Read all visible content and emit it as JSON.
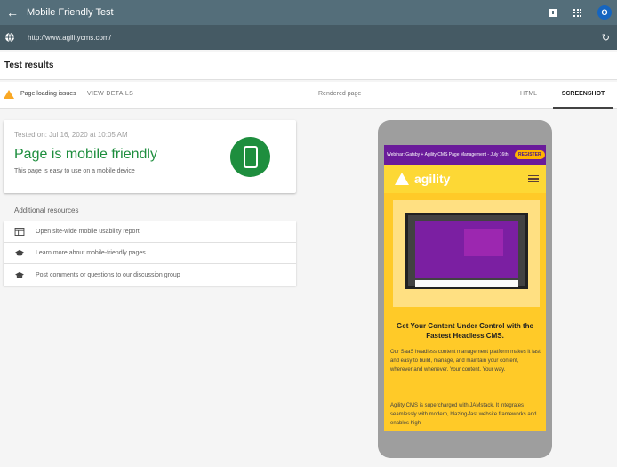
{
  "topbar": {
    "title": "Mobile Friendly Test",
    "back_icon": "arrow-left-icon",
    "avatar_initial": "O"
  },
  "urlbar": {
    "url": "http://www.agilitycms.com/"
  },
  "results": {
    "heading": "Test results"
  },
  "tabs": {
    "issues_label": "Page loading issues",
    "view_details": "VIEW DETAILS",
    "rendered_page": "Rendered page",
    "html": "HTML",
    "screenshot": "SCREENSHOT"
  },
  "summary": {
    "tested_on": "Tested on: Jul 16, 2020 at 10:05 AM",
    "headline": "Page is mobile friendly",
    "subtext": "This page is easy to use on a mobile device"
  },
  "resources": {
    "heading": "Additional resources",
    "items": [
      {
        "label": "Open site-wide mobile usability report",
        "icon": "table-icon"
      },
      {
        "label": "Learn more about mobile-friendly pages",
        "icon": "school-cap-icon"
      },
      {
        "label": "Post comments or questions to our discussion group",
        "icon": "school-cap-icon"
      }
    ]
  },
  "preview": {
    "banner_text": "Webinar: Gatsby + Agility CMS Page Management - July 16th",
    "register": "REGISTER",
    "brand": "agility",
    "hero_title": "Get Your Content Under Control with the Fastest Headless CMS.",
    "paragraph1": "Our SaaS headless content management platform makes it fast and easy to build, manage, and maintain your content, wherever and whenever. Your content. Your way.",
    "paragraph2": "Agility CMS is supercharged with JAMstack. It integrates seamlessly with modern, blazing-fast website frameworks and enables high"
  },
  "colors": {
    "topbar": "#546e7a",
    "urlbar": "#455a64",
    "success": "#1e8e3e",
    "warning": "#f9a825",
    "site_yellow": "#ffca28",
    "site_purple": "#6a1b9a"
  }
}
